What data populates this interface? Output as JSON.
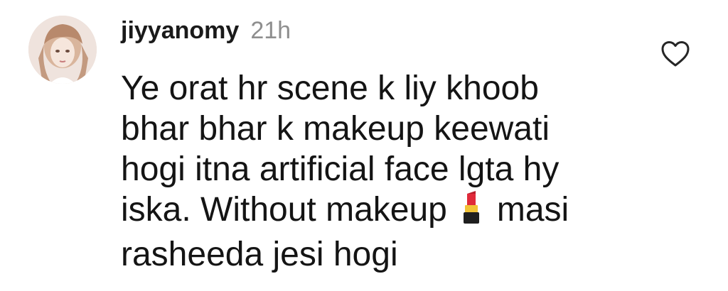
{
  "comment": {
    "username": "jiyyanomy",
    "time": "21h",
    "lines": [
      "Ye orat hr scene k liy khoob",
      "bhar bhar k makeup keewati",
      "hogi itna artificial face lgta hy",
      "iska. Without makeup",
      "masi",
      "rasheeda jesi hogi"
    ],
    "emoji": "lipstick-emoji",
    "like_icon": "heart-outline-icon",
    "avatar_icon": "profile-avatar"
  },
  "colors": {
    "text": "#141414",
    "muted": "#8e8e8e"
  }
}
